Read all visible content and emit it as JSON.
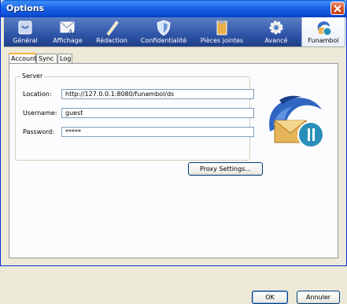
{
  "window": {
    "title": "Options"
  },
  "toolbar": {
    "items": [
      {
        "label": "Général",
        "icon": "general-icon"
      },
      {
        "label": "Affichage",
        "icon": "display-icon"
      },
      {
        "label": "Rédaction",
        "icon": "compose-icon"
      },
      {
        "label": "Confidentialité",
        "icon": "privacy-icon"
      },
      {
        "label": "Pièces jointes",
        "icon": "attachments-icon"
      },
      {
        "label": "Avancé",
        "icon": "advanced-icon"
      },
      {
        "label": "Funambol",
        "icon": "funambol-icon",
        "selected": true
      }
    ]
  },
  "subtabs": [
    {
      "label": "Account",
      "active": true
    },
    {
      "label": "Sync"
    },
    {
      "label": "Log"
    }
  ],
  "server": {
    "legend": "Server",
    "location_label": "Location:",
    "location_value": "http://127.0.0.1:8080/funambol/ds",
    "username_label": "Username:",
    "username_value": "guest",
    "password_label": "Password:",
    "password_value": "*****"
  },
  "buttons": {
    "proxy": "Proxy Settings...",
    "ok": "OK",
    "cancel": "Annuler"
  },
  "colors": {
    "titlebar": "#0c4fd6",
    "toolbar": "#2f55a8",
    "accent": "#f8b03a"
  }
}
